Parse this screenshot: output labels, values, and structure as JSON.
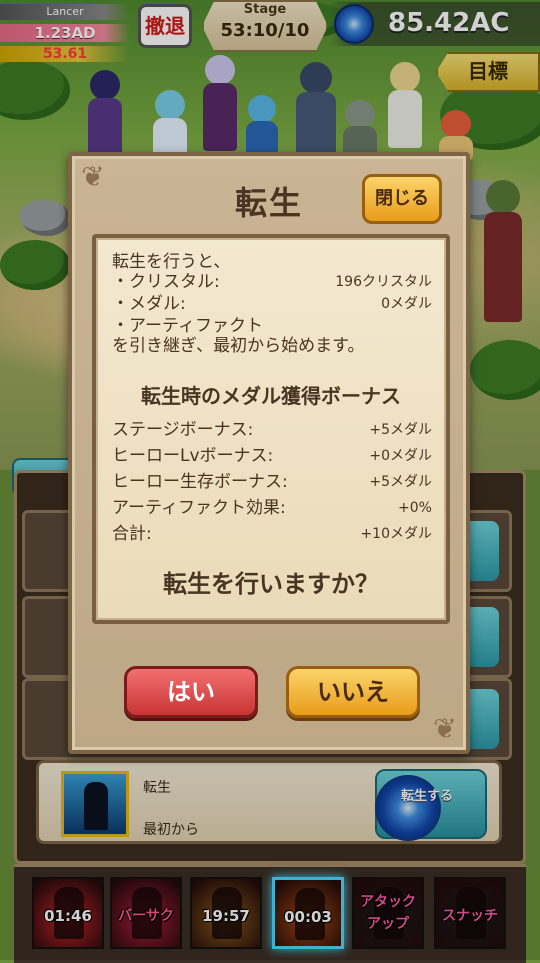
{
  "hud": {
    "player_name": "Lancer",
    "dps": "1.23AD",
    "gold": "53.61",
    "retreat_label": "撤退",
    "stage_label": "Stage",
    "stage_value": "53:10/10",
    "ac_value": "85.42AC",
    "goal_label": "目標"
  },
  "dialog": {
    "title": "転生",
    "close_label": "閉じる",
    "intro": "転生を行うと、",
    "items": [
      {
        "label": "・クリスタル:",
        "value": "196クリスタル"
      },
      {
        "label": "・メダル:",
        "value": "0メダル"
      },
      {
        "label": "・アーティファクト",
        "value": ""
      }
    ],
    "outro": "を引き継ぎ、最初から始めます。",
    "bonus_heading": "転生時のメダル獲得ボーナス",
    "bonuses": [
      {
        "label": "ステージボーナス:",
        "value": "+5メダル"
      },
      {
        "label": "ヒーローLvボーナス:",
        "value": "+0メダル"
      },
      {
        "label": "ヒーロー生存ボーナス:",
        "value": "+5メダル"
      },
      {
        "label": "アーティファクト効果:",
        "value": "+0%"
      },
      {
        "label": "合計:",
        "value": "+10メダル"
      }
    ],
    "question": "転生を行いますか？",
    "yes_label": "はい",
    "no_label": "いいえ"
  },
  "rebirth_row": {
    "title": "転生",
    "desc": "最初から",
    "button_label": "転生する"
  },
  "skills": [
    {
      "label": "01:46",
      "color": "#c8222a",
      "icon": "sword-skill-icon"
    },
    {
      "label": "バーサク",
      "color": "#b01e3a",
      "icon": "berserk-skill-icon"
    },
    {
      "label": "19:57",
      "color": "#8a5a1a",
      "icon": "warrior-skill-icon"
    },
    {
      "label": "00:03",
      "color": "#a84a10",
      "icon": "fire-skill-icon"
    },
    {
      "label": "アタック\nアップ",
      "color": "#1a1a1a",
      "icon": "attack-up-skill-icon"
    },
    {
      "label": "スナッチ",
      "color": "#1a1a1a",
      "icon": "snatch-skill-icon"
    }
  ]
}
